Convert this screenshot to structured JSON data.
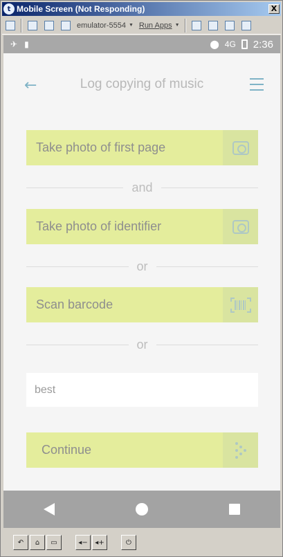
{
  "window": {
    "title": "Mobile Screen (Not Responding)",
    "close_label": "X"
  },
  "toolbar": {
    "device_combo": "emulator-5554",
    "run_apps": "Run Apps"
  },
  "status": {
    "network": "4G",
    "time": "2:36"
  },
  "appbar": {
    "title": "Log copying of music"
  },
  "actions": {
    "first_page": "Take photo of first page",
    "identifier": "Take photo of identifier",
    "barcode": "Scan barcode",
    "continue": "Continue"
  },
  "dividers": {
    "and": "and",
    "or1": "or",
    "or2": "or"
  },
  "input": {
    "value": "best"
  },
  "colors": {
    "action_bg": "#e4ed9c",
    "accent": "#7fb3c6",
    "nav_bg": "#a3a3a3"
  }
}
